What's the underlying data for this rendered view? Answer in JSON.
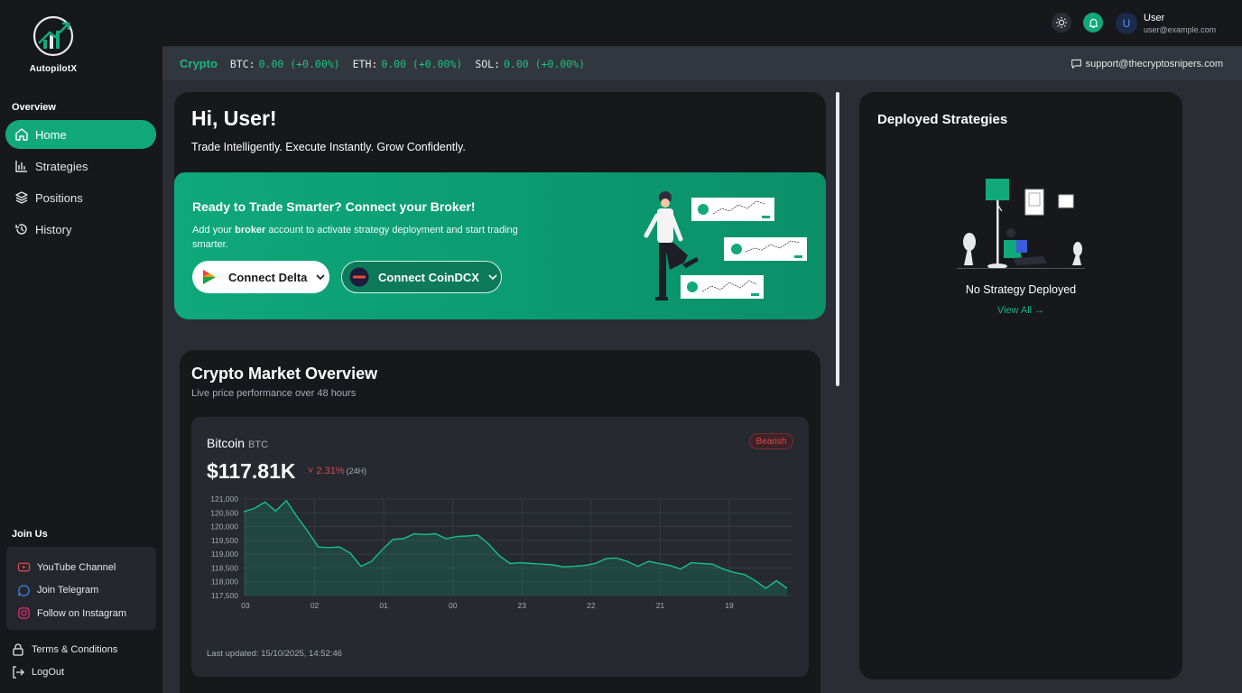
{
  "app": {
    "logo_text": "AutopilotX"
  },
  "sidebar": {
    "overview_label": "Overview",
    "nav": [
      {
        "label": "Home",
        "icon": "home-icon",
        "active": true
      },
      {
        "label": "Strategies",
        "icon": "bar-chart-icon",
        "active": false
      },
      {
        "label": "Positions",
        "icon": "layers-icon",
        "active": false
      },
      {
        "label": "History",
        "icon": "history-icon",
        "active": false
      }
    ],
    "join_label": "Join Us",
    "join_items": [
      {
        "label": "YouTube Channel",
        "icon": "youtube-icon",
        "color": "#e5484d"
      },
      {
        "label": "Join Telegram",
        "icon": "telegram-icon",
        "color": "#3b82f6"
      },
      {
        "label": "Follow on Instagram",
        "icon": "instagram-icon",
        "color": "#e1306c"
      }
    ],
    "terms_label": "Terms & Conditions",
    "logout_label": "LogOut"
  },
  "topbar": {
    "user_initial": "U",
    "user_name": "User",
    "user_email": "user@example.com"
  },
  "ticker": {
    "label": "Crypto",
    "items": [
      {
        "symbol": "BTC:",
        "value": "0.00 (+0.00%)"
      },
      {
        "symbol": "ETH:",
        "value": "0.00 (+0.00%)"
      },
      {
        "symbol": "SOL:",
        "value": "0.00 (+0.00%)"
      }
    ],
    "support_email": "support@thecryptosnipers.com"
  },
  "welcome": {
    "greeting": "Hi, User!",
    "tagline": "Trade Intelligently. Execute Instantly. Grow Confidently.",
    "broker_title": "Ready to Trade Smarter? Connect your Broker!",
    "broker_desc_pre": "Add your ",
    "broker_desc_bold": "broker",
    "broker_desc_post": " account to activate strategy deployment and start trading smarter.",
    "connect_delta": "Connect Delta",
    "connect_coindcx": "Connect CoinDCX"
  },
  "deployed": {
    "title": "Deployed Strategies",
    "empty_text": "No Strategy Deployed",
    "view_all": "View All →"
  },
  "market": {
    "title": "Crypto Market Overview",
    "subtitle": "Live price performance over 48 hours",
    "coin_name": "Bitcoin",
    "coin_symbol": "BTC",
    "trend_badge": "Bearish",
    "price": "$117.81K",
    "change": "˅ 2.31%",
    "change_period": "(24H)",
    "last_updated": "Last updated: 15/10/2025, 14:52:46"
  },
  "colors": {
    "accent": "#12a97a",
    "up": "#19c37d",
    "down": "#e0454f"
  },
  "chart_data": {
    "type": "area",
    "y_ticks": [
      "121,000",
      "120,500",
      "120,000",
      "119,500",
      "119,000",
      "118,500",
      "118,000",
      "117,500"
    ],
    "ylim": [
      117500,
      121000
    ],
    "x_ticks": [
      "03",
      "02",
      "01",
      "00",
      "23",
      "22",
      "21",
      "19"
    ],
    "series": [
      {
        "values": [
          120500,
          120700,
          120850,
          120600,
          120900,
          120400,
          119800,
          119300,
          119200,
          119300,
          119000,
          118600,
          118700,
          119200,
          119500,
          119600,
          119700,
          119750,
          119700,
          119600,
          119600,
          119700,
          119650,
          119400,
          118900,
          118700,
          118650,
          118700,
          118600,
          118650,
          118500,
          118600,
          118550,
          118700,
          118800,
          118900,
          118700,
          118600,
          118700,
          118700,
          118550,
          118500,
          118650,
          118700,
          118600,
          118500,
          118300,
          118300,
          118000,
          117800,
          118000,
          117800
        ]
      }
    ]
  }
}
